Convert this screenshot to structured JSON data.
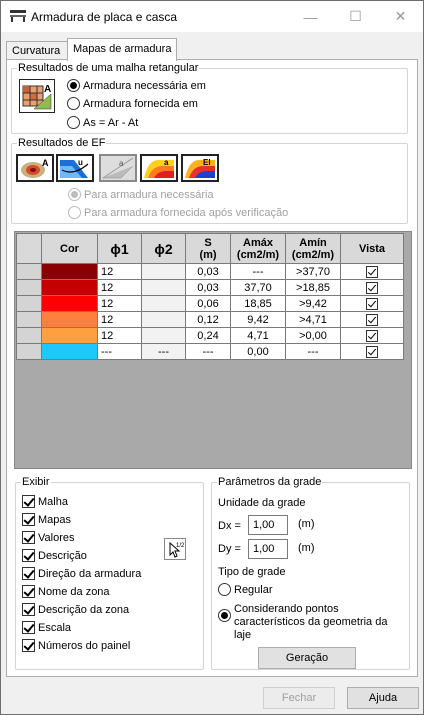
{
  "window": {
    "title": "Armadura de placa e casca",
    "minimize": "—",
    "maximize": "☐",
    "close": "✕"
  },
  "tabs": [
    {
      "label": "Curvatura",
      "active": false
    },
    {
      "label": "Mapas de armadura",
      "active": true
    }
  ],
  "mesh_results": {
    "label": "Resultados de uma malha retangular",
    "options": [
      {
        "label": "Armadura necessária em",
        "checked": true
      },
      {
        "label": "Armadura fornecida em",
        "checked": false
      },
      {
        "label": "As = Ar - At",
        "checked": false
      }
    ]
  },
  "fe_results": {
    "label": "Resultados de EF",
    "icon_names": [
      "fe-area-icon",
      "fe-bending-icon",
      "fe-shear-icon",
      "fe-reinforcement-icon",
      "fe-stiffness-icon"
    ],
    "options": [
      {
        "label": "Para armadura necessária",
        "checked": true
      },
      {
        "label": "Para armadura fornecida após verificação",
        "checked": false
      }
    ]
  },
  "table": {
    "headers": {
      "cor": "Cor",
      "phi1": "ϕ1",
      "phi2": "ϕ2",
      "s": "S",
      "s_unit": "(m)",
      "amax": "Amáx",
      "amax_unit": "(cm2/m)",
      "amin": "Amín",
      "amin_unit": "(cm2/m)",
      "vista": "Vista"
    },
    "rows": [
      {
        "color": "#8b0000",
        "phi1": "12",
        "phi2": "",
        "s": "0,03",
        "amax": "---",
        "amin": ">37,70",
        "vista": true
      },
      {
        "color": "#c40000",
        "phi1": "12",
        "phi2": "",
        "s": "0,03",
        "amax": "37,70",
        "amin": ">18,85",
        "vista": true
      },
      {
        "color": "#ff0000",
        "phi1": "12",
        "phi2": "",
        "s": "0,06",
        "amax": "18,85",
        "amin": ">9,42",
        "vista": true
      },
      {
        "color": "#ff7f3f",
        "phi1": "12",
        "phi2": "",
        "s": "0,12",
        "amax": "9,42",
        "amin": ">4,71",
        "vista": true
      },
      {
        "color": "#ffa040",
        "phi1": "12",
        "phi2": "",
        "s": "0,24",
        "amax": "4,71",
        "amin": ">0,00",
        "vista": true
      },
      {
        "color": "#1ec8ff",
        "phi1": "---",
        "phi2": "---",
        "s": "---",
        "amax": "0,00",
        "amin": "---",
        "vista": true
      }
    ]
  },
  "exibir": {
    "label": "Exibir",
    "items": [
      {
        "label": "Malha",
        "checked": true
      },
      {
        "label": "Mapas",
        "checked": true
      },
      {
        "label": "Valores",
        "checked": true
      },
      {
        "label": "Descrição",
        "checked": true
      },
      {
        "label": "Direção da armadura",
        "checked": true
      },
      {
        "label": "Nome da zona",
        "checked": true
      },
      {
        "label": "Descrição da zona",
        "checked": true
      },
      {
        "label": "Escala",
        "checked": true
      },
      {
        "label": "Números do painel",
        "checked": true
      }
    ]
  },
  "grid_params": {
    "label": "Parâmetros da grade",
    "unit_label": "Unidade da grade",
    "dx_label": "Dx =",
    "dx_value": "1,00",
    "dx_unit": "(m)",
    "dy_label": "Dy =",
    "dy_value": "1,00",
    "dy_unit": "(m)",
    "type_label": "Tipo de grade",
    "options": [
      {
        "label": "Regular",
        "checked": false
      },
      {
        "label": "Considerando pontos característicos da geometria da laje",
        "checked": true
      }
    ],
    "generate_button": "Geração"
  },
  "footer": {
    "close_button": "Fechar",
    "help_button": "Ajuda"
  },
  "colors": {
    "accent": "#000000",
    "disabled_text": "#a0a0a0",
    "header_bg": "#d9d9d9"
  }
}
